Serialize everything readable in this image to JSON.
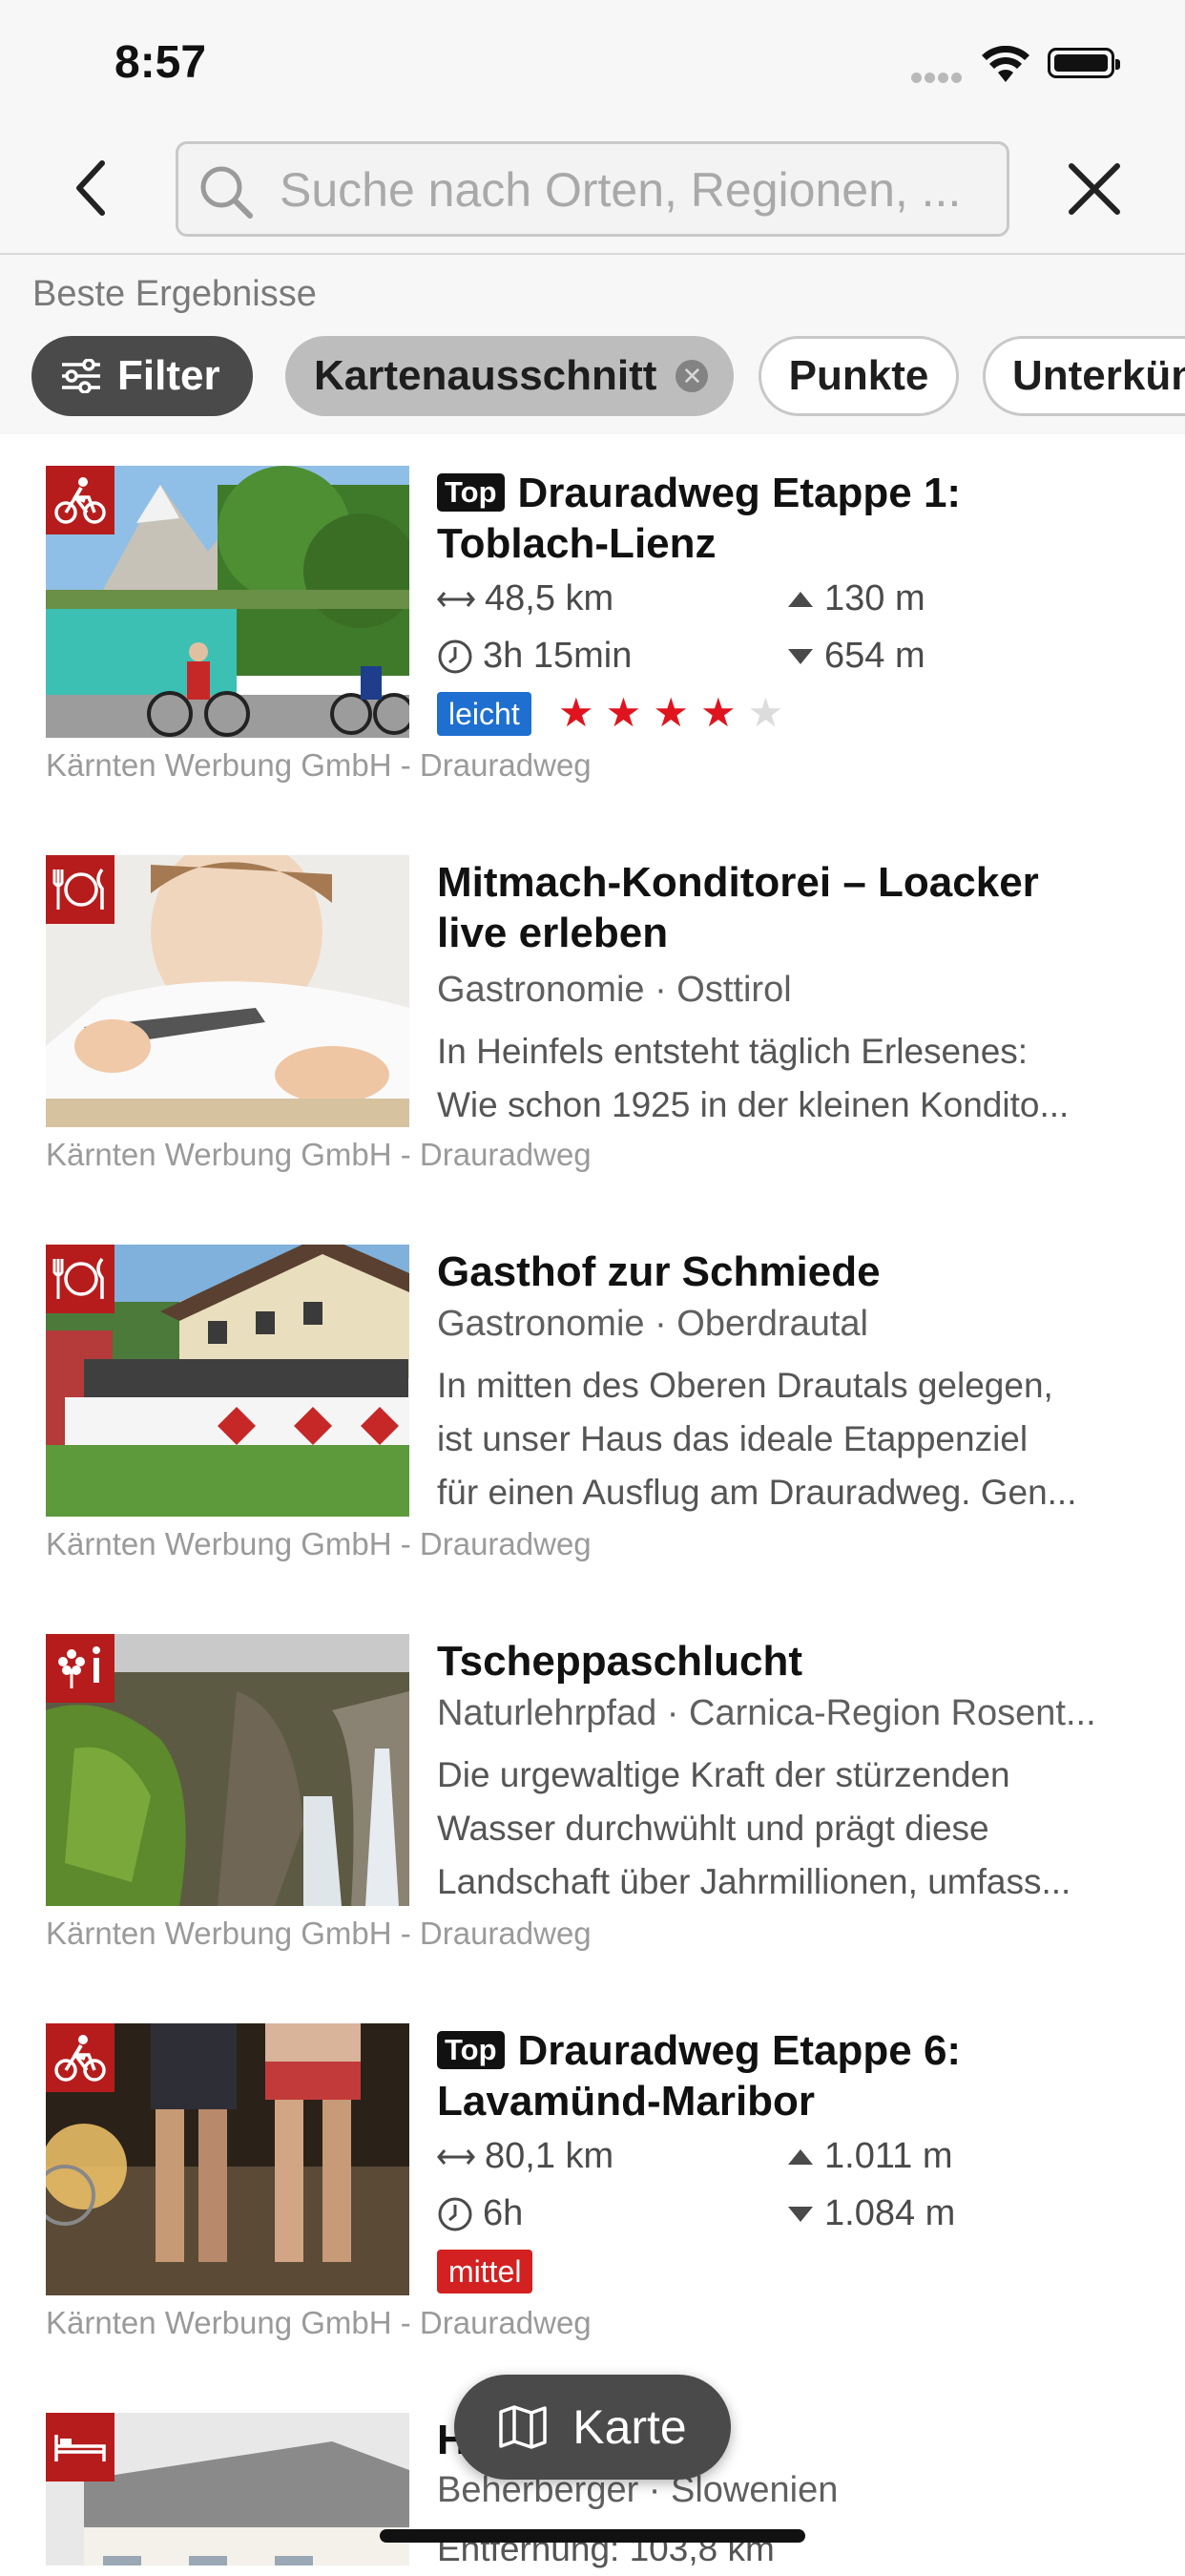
{
  "status_bar": {
    "time": "8:57"
  },
  "search": {
    "placeholder": "Suche nach Orten, Regionen, ..."
  },
  "filters": {
    "section_label": "Beste Ergebnisse",
    "filter_label": "Filter",
    "map_section_label": "Kartenausschnitt",
    "points_label": "Punkte",
    "accommodation_label": "Unterkün"
  },
  "results": [
    {
      "type": "tour",
      "top_label": "Top",
      "title_line1": "Drauradweg Etappe 1:",
      "title_line2": "Toblach-Lienz",
      "distance": "48,5 km",
      "duration": "3h 15min",
      "ascent": "130 m",
      "descent": "654 m",
      "difficulty": "leicht",
      "rating": 4,
      "rating_max": 5,
      "credit": "Kärnten Werbung GmbH - Drauradweg"
    },
    {
      "type": "poi",
      "title_line1": "Mitmach-Konditorei – Loacker",
      "title_line2": "live erleben",
      "subtitle": "Gastronomie · Osttirol",
      "desc_lines": [
        "In Heinfels entsteht täglich Erlesenes:",
        "Wie schon 1925 in der kleinen Kondito..."
      ],
      "credit": "Kärnten Werbung GmbH - Drauradweg"
    },
    {
      "type": "poi",
      "title": "Gasthof zur Schmiede",
      "subtitle": "Gastronomie · Oberdrautal",
      "desc_lines": [
        "In mitten des Oberen Drautals gelegen,",
        "ist unser Haus das ideale Etappenziel",
        "für einen Ausflug am Drauradweg. Gen..."
      ],
      "credit": "Kärnten Werbung GmbH - Drauradweg"
    },
    {
      "type": "poi",
      "title": "Tscheppaschlucht",
      "subtitle": "Naturlehrpfad · Carnica-Region Rosent...",
      "desc_lines": [
        "Die urgewaltige Kraft der stürzenden",
        "Wasser durchwühlt und prägt diese",
        "Landschaft über Jahrmillionen, umfass..."
      ],
      "credit": "Kärnten Werbung GmbH - Drauradweg"
    },
    {
      "type": "tour",
      "top_label": "Top",
      "title_line1": "Drauradweg Etappe 6:",
      "title_line2": "Lavamünd-Maribor",
      "distance": "80,1 km",
      "duration": "6h",
      "ascent": "1.011 m",
      "descent": "1.084 m",
      "difficulty": "mittel",
      "credit": "Kärnten Werbung GmbH - Drauradweg"
    },
    {
      "type": "poi",
      "title_partial": "H",
      "subtitle": "Beherberger · Slowenien",
      "desc_lines": [
        "Entfernung: 103,8 km"
      ]
    }
  ],
  "map_button": {
    "label": "Karte"
  },
  "colors": {
    "category_red": "#b71c1c",
    "easy_blue": "#1f6fd1",
    "medium_red": "#d32020",
    "star_red": "#e0141e",
    "chip_dark": "#4a4a4a"
  }
}
